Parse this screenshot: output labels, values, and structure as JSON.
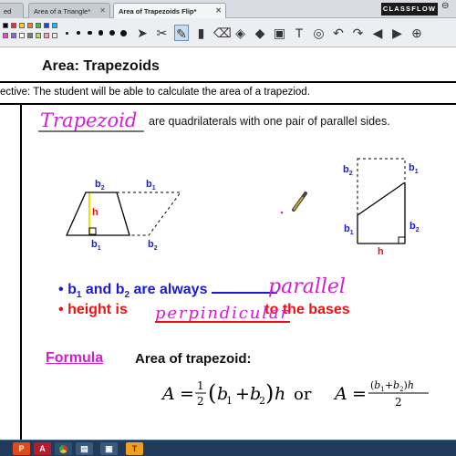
{
  "tabs": [
    {
      "label": "ed",
      "active": false
    },
    {
      "label": "Area of a Triangle*",
      "active": false
    },
    {
      "label": "Area of Trapezoids Flip*",
      "active": true
    }
  ],
  "brand": "CLASSFLOW",
  "palette": [
    "#000000",
    "#ff2a2a",
    "#ffd21c",
    "#ff7a1a",
    "#40c040",
    "#1a3fff",
    "#00c8ff",
    "#ff3ad0",
    "#9a5cff",
    "#ffffff",
    "#7a7a7a",
    "#b8e060",
    "#ff9ab0",
    "#f2ede0"
  ],
  "tools": [
    "arrow-select-icon",
    "tools-icon",
    "pen-icon",
    "highlighter-icon",
    "eraser-icon",
    "fill-icon",
    "shapes-icon",
    "image-icon",
    "text-icon",
    "capture-icon",
    "undo-icon",
    "redo-icon",
    "back-icon",
    "forward-icon",
    "zoom-icon"
  ],
  "page": {
    "title": "Area: Trapezoids",
    "objective": "ective: The student will be able to calculate the area of a trapeziod.",
    "definition": "are quadrilaterals with one pair of parallel sides.",
    "handwritten_term": "Trapezoid",
    "handwritten_parallel": "parallel",
    "handwritten_perpendicular": "perpindicular",
    "labels": {
      "b2": "b",
      "b1": "b",
      "sub1": "1",
      "sub2": "2",
      "h": "h"
    },
    "bullet1_pre": "b",
    "bullet1_sub1": "1",
    "bullet1_mid": " and b",
    "bullet1_sub2": "2",
    "bullet1_post": " are always",
    "bullet2_pre": "height is",
    "bullet2_post": "to the bases",
    "formula_link": "Formula",
    "formula_title": "Area of trapezoid:",
    "formula_or": "or"
  },
  "colors": {
    "blue": "#1a1adb",
    "red": "#ee1111",
    "magenta": "#d01fd0",
    "yellow": "#f0e000"
  }
}
